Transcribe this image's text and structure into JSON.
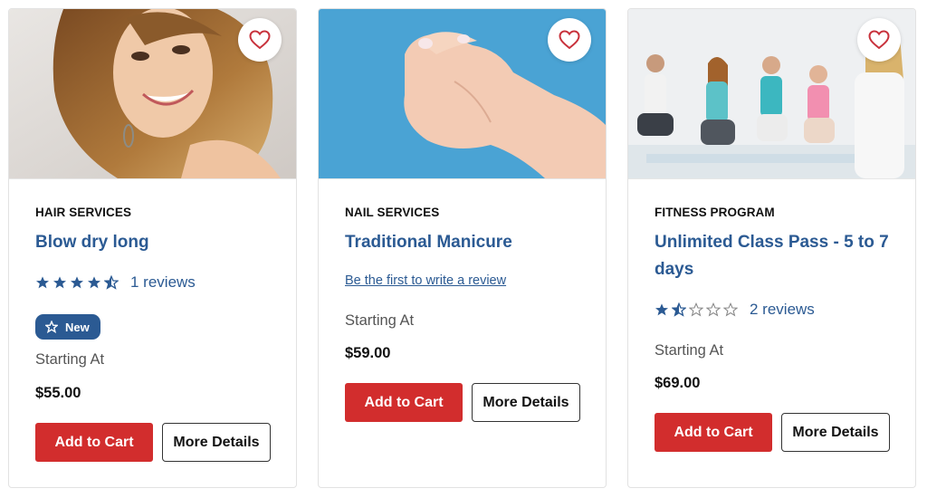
{
  "products": [
    {
      "category": "HAIR SERVICES",
      "title": "Blow dry long",
      "rating": 4.5,
      "reviews": "1 reviews",
      "badge": "New",
      "starting_label": "Starting At",
      "price": "$55.00",
      "add_to_cart": "Add to Cart",
      "more_details": "More Details"
    },
    {
      "category": "NAIL SERVICES",
      "title": "Traditional Manicure",
      "first_review": "Be the first to write a review",
      "starting_label": "Starting At",
      "price": "$59.00",
      "add_to_cart": "Add to Cart",
      "more_details": "More Details"
    },
    {
      "category": "FITNESS PROGRAM",
      "title": "Unlimited Class Pass - 5 to 7 days",
      "rating": 1.5,
      "reviews": "2 reviews",
      "starting_label": "Starting At",
      "price": "$69.00",
      "add_to_cart": "Add to Cart",
      "more_details": "More Details"
    }
  ],
  "colors": {
    "accent_blue": "#2b5a93",
    "cart_red": "#d22d2d",
    "heart_red": "#c8323c"
  },
  "icons": {
    "wishlist": "heart-outline-icon",
    "badge": "star-outline-icon",
    "rating": "star-icon"
  }
}
